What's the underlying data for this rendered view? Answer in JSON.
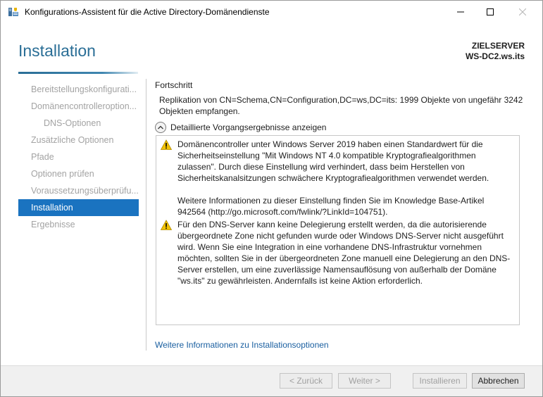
{
  "window": {
    "title": "Konfigurations-Assistent für die Active Directory-Domänendienste"
  },
  "header": {
    "page_title": "Installation",
    "target_label": "ZIELSERVER",
    "target_name": "WS-DC2.ws.its"
  },
  "sidebar": {
    "items": [
      {
        "label": "Bereitstellungskonfigurati...",
        "state": "disabled"
      },
      {
        "label": "Domänencontrolleroption...",
        "state": "disabled"
      },
      {
        "label": "DNS-Optionen",
        "state": "disabled",
        "sub": true
      },
      {
        "label": "Zusätzliche Optionen",
        "state": "disabled"
      },
      {
        "label": "Pfade",
        "state": "disabled"
      },
      {
        "label": "Optionen prüfen",
        "state": "disabled"
      },
      {
        "label": "Voraussetzungsüberprüfu...",
        "state": "disabled"
      },
      {
        "label": "Installation",
        "state": "active"
      },
      {
        "label": "Ergebnisse",
        "state": "disabled"
      }
    ]
  },
  "content": {
    "section_label": "Fortschritt",
    "progress_text": "Replikation von CN=Schema,CN=Configuration,DC=ws,DC=its: 1999 Objekte von ungefähr 3242 Objekten empfangen.",
    "details_toggle": "Detaillierte Vorgangsergebnisse anzeigen",
    "messages": [
      {
        "icon": "warning-icon",
        "paragraphs": [
          "Domänencontroller unter Windows Server 2019 haben einen Standardwert für die Sicherheitseinstellung \"Mit Windows NT 4.0 kompatible Kryptografiealgorithmen zulassen\". Durch diese Einstellung wird verhindert, dass beim Herstellen von Sicherheitskanalsitzungen schwächere Kryptografiealgorithmen verwendet werden.",
          "Weitere Informationen zu dieser Einstellung finden Sie im Knowledge Base-Artikel 942564 (http://go.microsoft.com/fwlink/?LinkId=104751)."
        ]
      },
      {
        "icon": "warning-icon",
        "paragraphs": [
          "Für den DNS-Server kann keine Delegierung erstellt werden, da die autorisierende übergeordnete Zone nicht gefunden wurde oder Windows DNS-Server nicht ausgeführt wird. Wenn Sie eine Integration in eine vorhandene DNS-Infrastruktur vornehmen möchten, sollten Sie in der übergeordneten Zone manuell eine Delegierung an den DNS-Server erstellen, um eine zuverlässige Namensauflösung von außerhalb der Domäne \"ws.its\" zu gewährleisten. Andernfalls ist keine Aktion erforderlich."
        ]
      }
    ],
    "more_link": "Weitere Informationen zu Installationsoptionen"
  },
  "footer": {
    "back_label": "< Zurück",
    "next_label": "Weiter >",
    "install_label": "Installieren",
    "cancel_label": "Abbrechen"
  },
  "colors": {
    "accent": "#2a6e96",
    "nav_active": "#1a73c0",
    "link": "#1a5fa0",
    "warning": "#f2c200"
  }
}
